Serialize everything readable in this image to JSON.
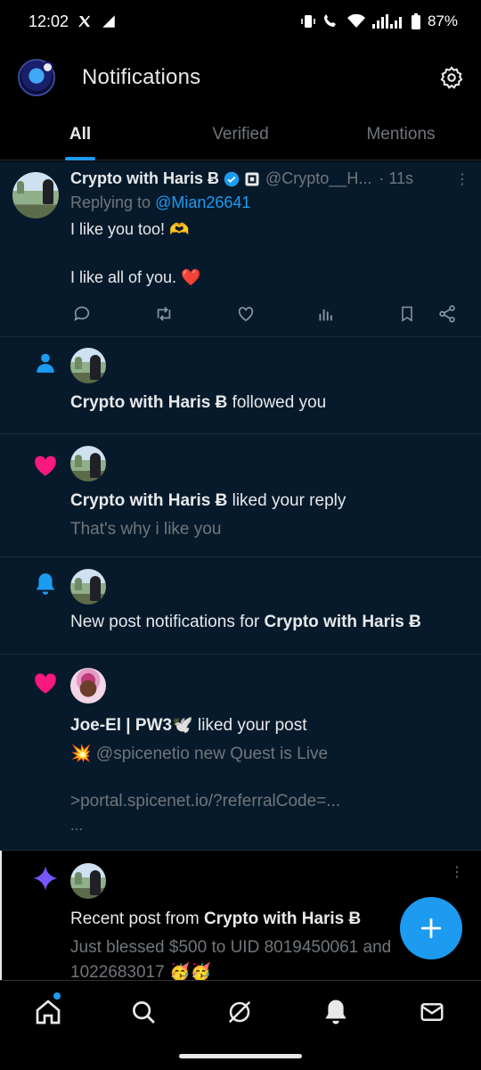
{
  "status": {
    "time": "12:02",
    "battery": "87%"
  },
  "header": {
    "title": "Notifications"
  },
  "tabs": [
    {
      "label": "All",
      "active": true
    },
    {
      "label": "Verified",
      "active": false
    },
    {
      "label": "Mentions",
      "active": false
    }
  ],
  "tweet": {
    "name": "Crypto with Haris Ƀ",
    "handle": "@Crypto__H...",
    "time": "· 11s",
    "replying_prefix": "Replying to ",
    "replying_to": "@Mian26641",
    "line1": "I like you too! 🫶",
    "line2": "I like all of you. ❤️"
  },
  "notifications": {
    "follow": {
      "name": "Crypto with Haris Ƀ",
      "text": " followed you"
    },
    "like_reply": {
      "name": "Crypto with Haris Ƀ",
      "text": " liked your reply",
      "sub": "That's why i like you"
    },
    "new_post": {
      "text": "New post notifications for ",
      "name": "Crypto with Haris Ƀ"
    },
    "like_post": {
      "name": "Joe-El | PW3🕊️",
      "text": " liked your post",
      "sub1": "💥 @spicenetio new Quest is Live",
      "sub2": ">portal.spicenet.io/?referralCode=...",
      "sub3": "..."
    },
    "recent": {
      "text": "Recent post from ",
      "name": "Crypto with Haris Ƀ",
      "sub1": "Just blessed $500 to UID 8019450061 and",
      "sub2": "1022683017 🥳🥳"
    }
  },
  "colors": {
    "accent": "#1d9bf0",
    "like": "#f91880",
    "spark": "#7856ff"
  }
}
